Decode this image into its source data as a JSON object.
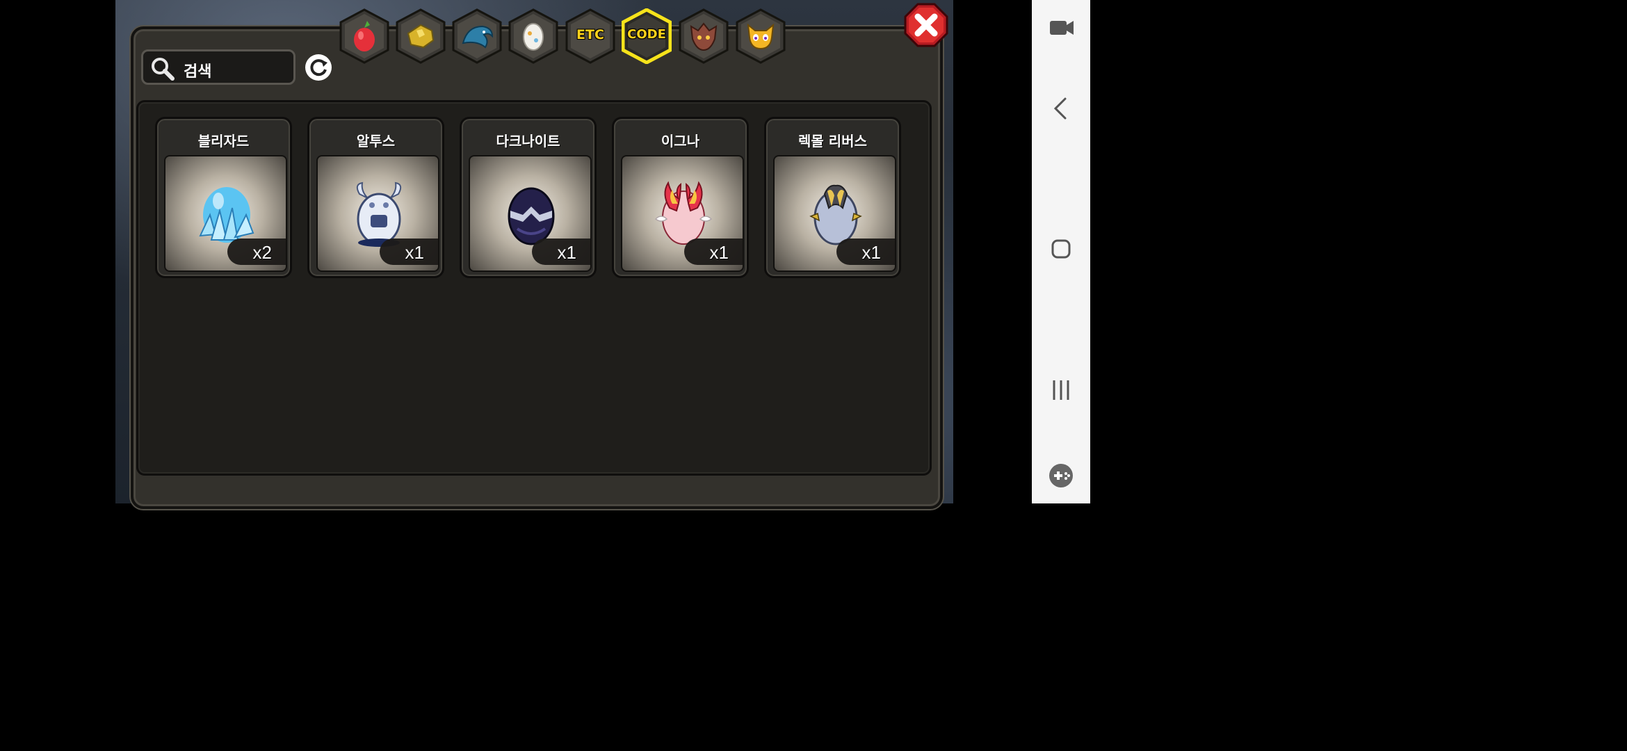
{
  "search": {
    "placeholder": "검색"
  },
  "tabs": [
    {
      "id": "fruit",
      "icon": "red-fruit-icon",
      "label": ""
    },
    {
      "id": "material",
      "icon": "gold-ore-icon",
      "label": ""
    },
    {
      "id": "dragon",
      "icon": "blue-dragon-icon",
      "label": ""
    },
    {
      "id": "egg",
      "icon": "egg-icon",
      "label": ""
    },
    {
      "id": "etc",
      "icon": "etc-icon",
      "label": "ETC"
    },
    {
      "id": "code",
      "icon": "code-icon",
      "label": "CODE",
      "selected": true
    },
    {
      "id": "beast",
      "icon": "beast-head-icon",
      "label": ""
    },
    {
      "id": "pet",
      "icon": "pet-face-icon",
      "label": ""
    }
  ],
  "items": [
    {
      "name": "블리자드",
      "count": "x2",
      "icon": "ice-crystal-egg-icon"
    },
    {
      "name": "알투스",
      "count": "x1",
      "icon": "white-horned-egg-icon"
    },
    {
      "name": "다크나이트",
      "count": "x1",
      "icon": "dark-armored-egg-icon"
    },
    {
      "name": "이그나",
      "count": "x1",
      "icon": "pink-flame-egg-icon"
    },
    {
      "name": "렉몰 리버스",
      "count": "x1",
      "icon": "silver-gold-egg-icon"
    }
  ],
  "colors": {
    "selected_tab_glow": "#f7e31b",
    "tab_label": "#ffd21a",
    "close_red": "#d8262b"
  }
}
